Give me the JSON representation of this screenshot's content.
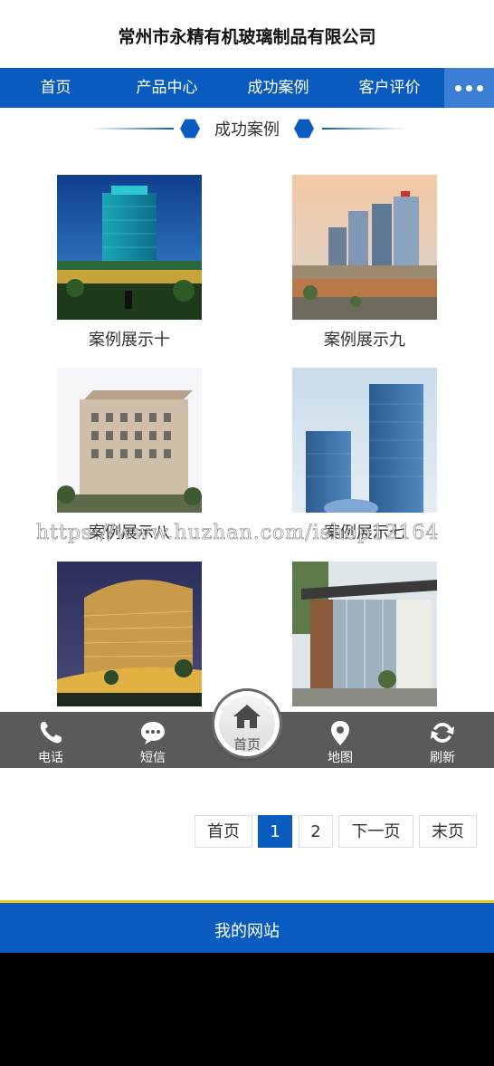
{
  "header": {
    "title": "常州市永精有机玻璃制品有限公司"
  },
  "nav": {
    "items": [
      "首页",
      "产品中心",
      "成功案例",
      "客户评价"
    ],
    "more_icon": "more-dots-icon"
  },
  "section": {
    "title": "成功案例"
  },
  "cases": [
    {
      "caption": "案例展示十"
    },
    {
      "caption": "案例展示九"
    },
    {
      "caption": "案例展示八"
    },
    {
      "caption": "案例展示七"
    },
    {
      "caption": ""
    },
    {
      "caption": ""
    }
  ],
  "watermark": "https://www.huzhan.com/ishop12164",
  "bottom_bar": {
    "items": [
      {
        "label": "电话",
        "icon": "phone-icon"
      },
      {
        "label": "短信",
        "icon": "sms-icon"
      },
      {
        "label": "首页",
        "icon": "home-icon"
      },
      {
        "label": "地图",
        "icon": "map-pin-icon"
      },
      {
        "label": "刷新",
        "icon": "refresh-icon"
      }
    ]
  },
  "pagination": {
    "first": "首页",
    "pages": [
      "1",
      "2"
    ],
    "current": "1",
    "next": "下一页",
    "last": "末页"
  },
  "footer": {
    "text": "我的网站"
  },
  "colors": {
    "primary": "#0a5bbf",
    "accent_border": "#f1c40f",
    "bar": "#5a5a5a"
  }
}
